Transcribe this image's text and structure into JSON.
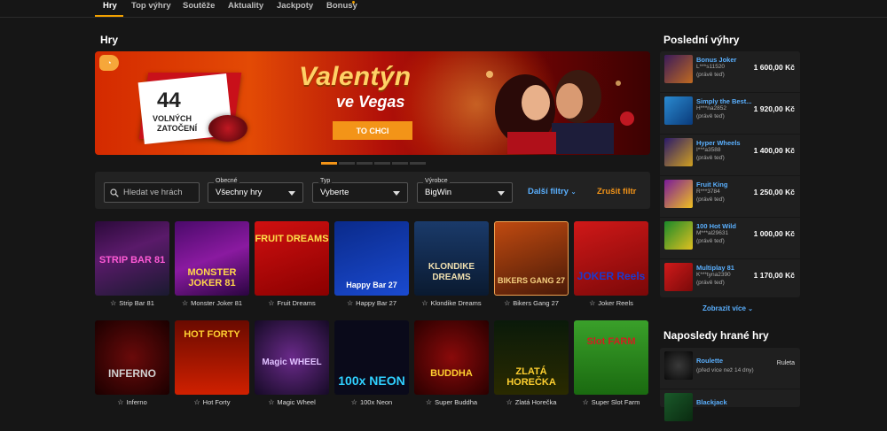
{
  "nav": {
    "tabs": [
      "Hry",
      "Top výhry",
      "Soutěže",
      "Aktuality",
      "Jackpoty",
      "Bonusy"
    ]
  },
  "main": {
    "title": "Hry",
    "banner": {
      "free_count": "44",
      "free_line1": "VOLNÝCH",
      "free_line2": "ZATOČENÍ",
      "headline1": "Valentýn",
      "headline2": "ve Vegas",
      "cta": "TO CHCI"
    },
    "filters": {
      "search_placeholder": "Hledat ve hrách",
      "general_label": "Obecné",
      "general_value": "Všechny hry",
      "type_label": "Typ",
      "type_value": "Vyberte",
      "vendor_label": "Výrobce",
      "vendor_value": "BigWin",
      "more_filters": "Další filtry",
      "clear_filters": "Zrušit filtr"
    },
    "games_row1": [
      {
        "name": "Strip Bar 81",
        "art": "STRIP BAR 81"
      },
      {
        "name": "Monster Joker 81",
        "art": "MONSTER JOKER 81"
      },
      {
        "name": "Fruit Dreams",
        "art": "FRUIT DREAMS"
      },
      {
        "name": "Happy Bar 27",
        "art": "Happy Bar 27"
      },
      {
        "name": "Klondike Dreams",
        "art": "KLONDIKE DREAMS"
      },
      {
        "name": "Bikers Gang 27",
        "art": "BIKERS GANG 27"
      },
      {
        "name": "Joker Reels",
        "art": "JOKER Reels"
      }
    ],
    "games_row2": [
      {
        "name": "Inferno",
        "art": "INFERNO"
      },
      {
        "name": "Hot Forty",
        "art": "HOT FORTY"
      },
      {
        "name": "Magic Wheel",
        "art": "Magic WHEEL"
      },
      {
        "name": "100x Neon",
        "art": "100x NEON"
      },
      {
        "name": "Super Buddha",
        "art": "BUDDHA"
      },
      {
        "name": "Zlatá Horečka",
        "art": "ZLATÁ HOREČKA"
      },
      {
        "name": "Super Slot Farm",
        "art": "Slot FARM"
      }
    ]
  },
  "sidebar": {
    "latest_title": "Poslední výhry",
    "winners": [
      {
        "game": "Bonus Joker",
        "user": "L***s11520",
        "time": "(právě teď)",
        "amount": "1 600,00 Kč"
      },
      {
        "game": "Simply the Best...",
        "user": "H***na2852",
        "time": "(právě teď)",
        "amount": "1 920,00 Kč"
      },
      {
        "game": "Hyper Wheels",
        "user": "I***a3588",
        "time": "(právě teď)",
        "amount": "1 400,00 Kč"
      },
      {
        "game": "Fruit King",
        "user": "R***3784",
        "time": "(právě teď)",
        "amount": "1 250,00 Kč"
      },
      {
        "game": "100 Hot Wild",
        "user": "M***al29631",
        "time": "(právě teď)",
        "amount": "1 000,00 Kč"
      },
      {
        "game": "Multiplay 81",
        "user": "K***tyna2390",
        "time": "(právě teď)",
        "amount": "1 170,00 Kč"
      }
    ],
    "show_more": "Zobrazit více",
    "recent_title": "Naposledy hrané hry",
    "recent": [
      {
        "game": "Roulette",
        "time": "(před více než 14 dny)",
        "type": "Ruleta"
      },
      {
        "game": "Blackjack"
      }
    ]
  }
}
